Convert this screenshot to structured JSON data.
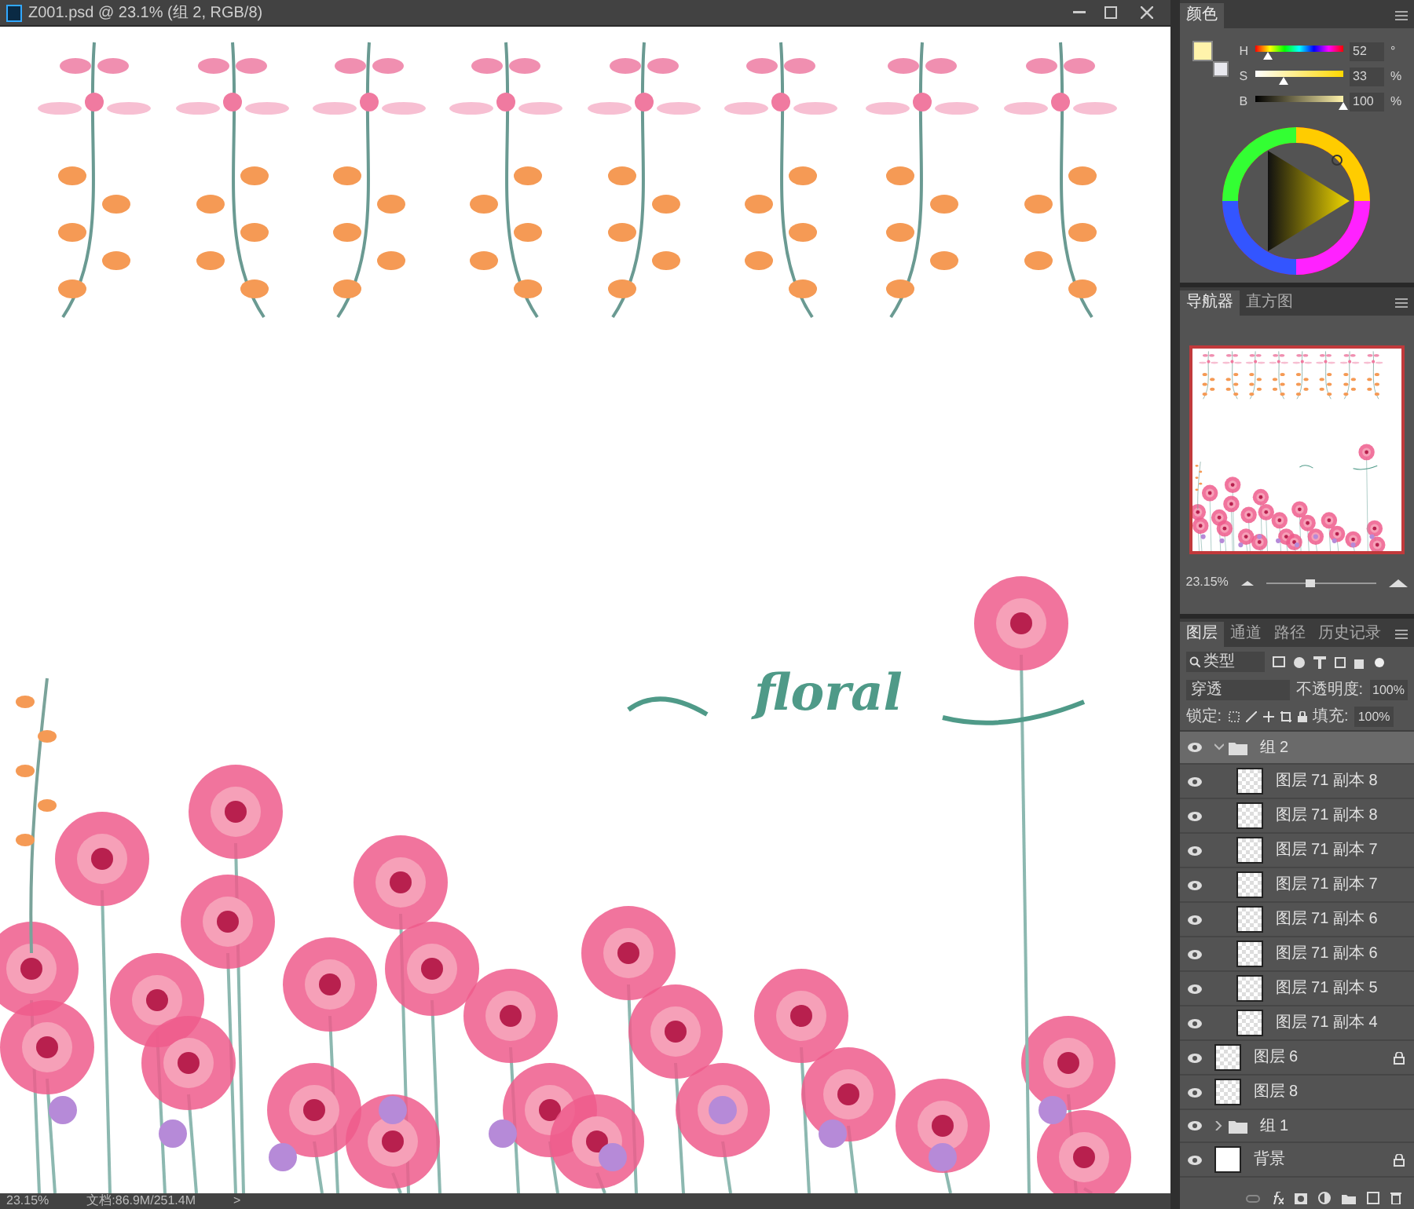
{
  "document": {
    "title": "Z001.psd @ 23.1% (组 2, RGB/8)",
    "canvas": {
      "caption": "floral"
    },
    "status_bar": {
      "zoom": "23.15%",
      "doc_size": "文档:86.9M/251.4M",
      "arrow": ">"
    }
  },
  "color_panel": {
    "tabs": [
      {
        "label": "颜色",
        "selected": true
      }
    ],
    "foreground": {
      "color": "#fff3ab"
    },
    "sliders": [
      {
        "kind": "hue",
        "label": "H",
        "level": 0.144,
        "value": "52",
        "unit": "°"
      },
      {
        "kind": "saturation",
        "label": "S",
        "level": 0.33,
        "value": "33",
        "unit": "%"
      },
      {
        "kind": "brightness",
        "label": "B",
        "level": 1.0,
        "value": "100",
        "unit": "%"
      }
    ]
  },
  "navigator_panel": {
    "tabs": [
      {
        "label": "导航器",
        "selected": true
      },
      {
        "label": "直方图",
        "selected": false
      }
    ],
    "zoom": "23.15%",
    "zoom_slider": {
      "level": 0.4
    }
  },
  "layers_panel": {
    "tabs": [
      {
        "label": "图层",
        "selected": true
      },
      {
        "label": "通道",
        "selected": false
      },
      {
        "label": "路径",
        "selected": false
      },
      {
        "label": "历史记录",
        "selected": false
      }
    ],
    "filter": "类型",
    "blend_mode": "穿透",
    "opacity_label": "不透明度:",
    "opacity": "100%",
    "lock_label": "锁定:",
    "fill_label": "填充:",
    "fill": "100%",
    "layers": [
      {
        "kind": "group",
        "name": "组 2",
        "visible": true,
        "locked": false,
        "selected": true,
        "expanded": true,
        "children": [
          {
            "kind": "layer",
            "name": "图层 71 副本 8",
            "visible": true,
            "locked": false,
            "selected": false
          },
          {
            "kind": "layer",
            "name": "图层 71 副本 8",
            "visible": true,
            "locked": false,
            "selected": false
          },
          {
            "kind": "layer",
            "name": "图层 71 副本 7",
            "visible": true,
            "locked": false,
            "selected": false
          },
          {
            "kind": "layer",
            "name": "图层 71 副本 7",
            "visible": true,
            "locked": false,
            "selected": false
          },
          {
            "kind": "layer",
            "name": "图层 71 副本 6",
            "visible": true,
            "locked": false,
            "selected": false
          },
          {
            "kind": "layer",
            "name": "图层 71 副本 6",
            "visible": true,
            "locked": false,
            "selected": false
          },
          {
            "kind": "layer",
            "name": "图层 71 副本 5",
            "visible": true,
            "locked": false,
            "selected": false
          },
          {
            "kind": "layer",
            "name": "图层 71 副本 4",
            "visible": true,
            "locked": false,
            "selected": false
          }
        ]
      },
      {
        "kind": "layer",
        "name": "图层 6",
        "visible": true,
        "locked": true,
        "selected": false
      },
      {
        "kind": "layer",
        "name": "图层 8",
        "visible": true,
        "locked": false,
        "selected": false
      },
      {
        "kind": "group",
        "name": "组 1",
        "visible": true,
        "locked": false,
        "selected": false,
        "expanded": false
      },
      {
        "kind": "background",
        "name": "背景",
        "visible": true,
        "locked": true,
        "selected": false
      }
    ]
  }
}
